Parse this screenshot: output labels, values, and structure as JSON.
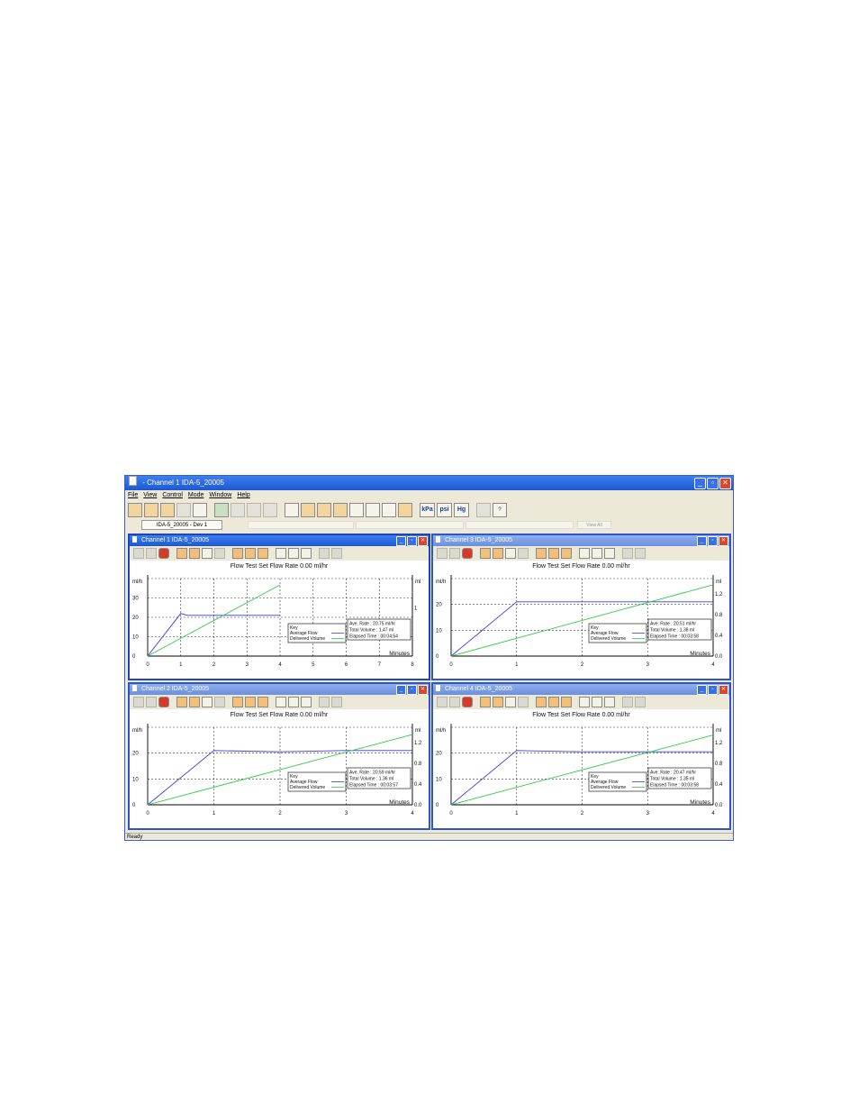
{
  "app": {
    "title": "- Channel 1 IDA-5_20005",
    "menu": [
      "File",
      "View",
      "Control",
      "Mode",
      "Window",
      "Help"
    ],
    "unit_buttons": [
      "kPa",
      "psi",
      "Hg"
    ],
    "device_tab": "IDA-5_20005 - Dev 1",
    "faded_tab": "View All",
    "status": "Ready"
  },
  "colors": {
    "avg_flow": "#3b3bd6",
    "delivered": "#2ecc40",
    "titlebar": "#1d58d0"
  },
  "windows": [
    {
      "title": "Channel 1 IDA-5_20005",
      "heading": "Flow Test   Set Flow Rate 0.00 ml/hr",
      "left_unit": "ml/h",
      "right_unit": "ml",
      "x_unit": "Minutes",
      "legend": {
        "title": "Key",
        "avg": "Average Flow",
        "delivered": "Delivered Volume"
      },
      "stats": {
        "rate": "Ave. Rate : 20.75 ml/hr",
        "volume": "Total Volume : 1.47 ml",
        "time": "Elapsed Time : 00:04:54"
      }
    },
    {
      "title": "Channel 3 IDA-5_20005",
      "heading": "Flow Test   Set Flow Rate 0.00 ml/hr",
      "left_unit": "ml/h",
      "right_unit": "ml",
      "x_unit": "Minutes",
      "legend": {
        "title": "Key",
        "avg": "Average Flow",
        "delivered": "Delivered Volume"
      },
      "stats": {
        "rate": "Ave. Rate : 20.51 ml/hr",
        "volume": "Total Volume : 1.38 ml",
        "time": "Elapsed Time : 00:03:58"
      }
    },
    {
      "title": "Channel 2 IDA-5_20005",
      "heading": "Flow Test   Set Flow Rate 0.00 ml/hr",
      "left_unit": "ml/h",
      "right_unit": "ml",
      "x_unit": "Minutes",
      "legend": {
        "title": "Key",
        "avg": "Average Flow",
        "delivered": "Delivered Volume"
      },
      "stats": {
        "rate": "Ave. Rate : 20.59 ml/hr",
        "volume": "Total Volume : 1.36 ml",
        "time": "Elapsed Time : 00:03:57"
      }
    },
    {
      "title": "Channel 4 IDA-5_20005",
      "heading": "Flow Test   Set Flow Rate 0.00 ml/hr",
      "left_unit": "ml/h",
      "right_unit": "ml",
      "x_unit": "Minutes",
      "legend": {
        "title": "Key",
        "avg": "Average Flow",
        "delivered": "Delivered Volume"
      },
      "stats": {
        "rate": "Ave. Rate : 20.47 ml/hr",
        "volume": "Total Volume : 1.35 ml",
        "time": "Elapsed Time : 00:03:58"
      }
    }
  ],
  "chart_data": [
    {
      "type": "line",
      "x_ticks": [
        "0",
        "1",
        "2",
        "3",
        "4",
        "5",
        "6",
        "7",
        "8"
      ],
      "xlim": [
        0,
        8
      ],
      "y_left_ticks": [
        "0",
        "10",
        "20",
        "30"
      ],
      "ylim_left": [
        0,
        40
      ],
      "y_right_ticks": [
        "1"
      ],
      "ylim_right": [
        0,
        1.6
      ],
      "series": [
        {
          "name": "Average Flow",
          "axis": "left",
          "x": [
            0,
            1,
            1.2,
            2,
            3,
            4
          ],
          "y": [
            0,
            22,
            21,
            21,
            21,
            21
          ]
        },
        {
          "name": "Delivered Volume",
          "axis": "right",
          "x": [
            0,
            4
          ],
          "y": [
            0,
            1.47
          ]
        }
      ]
    },
    {
      "type": "line",
      "x_ticks": [
        "0",
        "1",
        "2",
        "3",
        "4"
      ],
      "xlim": [
        0,
        4
      ],
      "y_left_ticks": [
        "0",
        "10",
        "20"
      ],
      "ylim_left": [
        0,
        30
      ],
      "y_right_ticks": [
        "0.0",
        "0.4",
        "0.8",
        "1.2"
      ],
      "ylim_right": [
        0,
        1.5
      ],
      "series": [
        {
          "name": "Average Flow",
          "axis": "left",
          "x": [
            0,
            1,
            2,
            3,
            4
          ],
          "y": [
            0,
            21,
            21,
            21,
            21
          ]
        },
        {
          "name": "Delivered Volume",
          "axis": "right",
          "x": [
            0,
            4
          ],
          "y": [
            0,
            1.38
          ]
        }
      ]
    },
    {
      "type": "line",
      "x_ticks": [
        "0",
        "1",
        "2",
        "3",
        "4"
      ],
      "xlim": [
        0,
        4
      ],
      "y_left_ticks": [
        "0",
        "10",
        "20"
      ],
      "ylim_left": [
        0,
        30
      ],
      "y_right_ticks": [
        "0.0",
        "0.4",
        "0.8",
        "1.2"
      ],
      "ylim_right": [
        0,
        1.5
      ],
      "series": [
        {
          "name": "Average Flow",
          "axis": "left",
          "x": [
            0,
            1,
            2,
            3,
            4
          ],
          "y": [
            0,
            21,
            20.5,
            21,
            21
          ]
        },
        {
          "name": "Delivered Volume",
          "axis": "right",
          "x": [
            0,
            4
          ],
          "y": [
            0,
            1.36
          ]
        }
      ]
    },
    {
      "type": "line",
      "x_ticks": [
        "0",
        "1",
        "2",
        "3",
        "4"
      ],
      "xlim": [
        0,
        4
      ],
      "y_left_ticks": [
        "0",
        "10",
        "20"
      ],
      "ylim_left": [
        0,
        30
      ],
      "y_right_ticks": [
        "0.0",
        "0.4",
        "0.8",
        "1.2"
      ],
      "ylim_right": [
        0,
        1.5
      ],
      "series": [
        {
          "name": "Average Flow",
          "axis": "left",
          "x": [
            0,
            1,
            2,
            3,
            4
          ],
          "y": [
            0,
            21,
            20.5,
            20.5,
            20.5
          ]
        },
        {
          "name": "Delivered Volume",
          "axis": "right",
          "x": [
            0,
            4
          ],
          "y": [
            0,
            1.35
          ]
        }
      ]
    }
  ]
}
